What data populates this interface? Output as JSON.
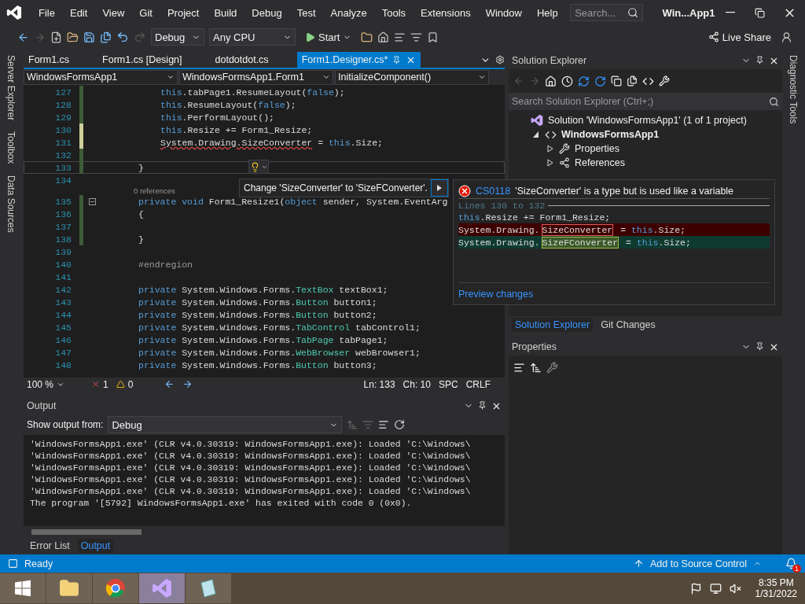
{
  "menubar": {
    "menus": [
      "File",
      "Edit",
      "View",
      "Git",
      "Project",
      "Build",
      "Debug",
      "Test",
      "Analyze",
      "Tools",
      "Extensions",
      "Window",
      "Help"
    ],
    "search": {
      "placeholder": "Search..."
    },
    "title": "Win...App1"
  },
  "toolbar": {
    "configuration": "Debug",
    "platform": "Any CPU",
    "start": "Start",
    "live_share": "Live Share"
  },
  "left_tabs": [
    "Server Explorer",
    "Toolbox",
    "Data Sources"
  ],
  "right_tabs": [
    "Diagnostic Tools"
  ],
  "editor": {
    "tabs": [
      {
        "label": "Form1.cs",
        "selected": false
      },
      {
        "label": "Form1.cs [Design]",
        "selected": false
      },
      {
        "label": "dotdotdot.cs",
        "selected": false
      },
      {
        "label": "Form1.Designer.cs*",
        "selected": true
      }
    ],
    "nav": [
      "WindowsFormsApp1",
      "WindowsFormsApp1.Form1",
      "InitializeComponent()"
    ],
    "lines": [
      {
        "n": "127",
        "kind": "body",
        "changed": true,
        "unsaved": false,
        "current": false,
        "fold": false,
        "tokens": [
          {
            "text": "this",
            "kind": "keyword"
          },
          {
            "text": ".tabPage1.ResumeLayout(",
            "kind": "plain"
          },
          {
            "text": "false",
            "kind": "keyword"
          },
          {
            "text": ");",
            "kind": "plain"
          }
        ]
      },
      {
        "n": "128",
        "kind": "body",
        "changed": true,
        "unsaved": false,
        "current": false,
        "fold": false,
        "tokens": [
          {
            "text": "this",
            "kind": "keyword"
          },
          {
            "text": ".ResumeLayout(",
            "kind": "plain"
          },
          {
            "text": "false",
            "kind": "keyword"
          },
          {
            "text": ");",
            "kind": "plain"
          }
        ]
      },
      {
        "n": "129",
        "kind": "body",
        "changed": true,
        "unsaved": false,
        "current": false,
        "fold": false,
        "tokens": [
          {
            "text": "this",
            "kind": "keyword"
          },
          {
            "text": ".PerformLayout();",
            "kind": "plain"
          }
        ]
      },
      {
        "n": "130",
        "kind": "body",
        "changed": true,
        "unsaved": true,
        "current": false,
        "fold": false,
        "tokens": [
          {
            "text": "this",
            "kind": "keyword"
          },
          {
            "text": ".Resize += Form1_Resize;",
            "kind": "plain"
          }
        ]
      },
      {
        "n": "131",
        "kind": "body",
        "changed": true,
        "unsaved": true,
        "current": false,
        "fold": false,
        "tokens": [
          {
            "text": "System.Drawing.SizeConverter",
            "kind": "error"
          },
          {
            "text": " = ",
            "kind": "plain"
          },
          {
            "text": "this",
            "kind": "keyword"
          },
          {
            "text": ".Size;",
            "kind": "plain"
          }
        ]
      },
      {
        "n": "132",
        "kind": "body",
        "changed": true,
        "unsaved": false,
        "current": false,
        "fold": false
      },
      {
        "n": "133",
        "kind": "member",
        "changed": true,
        "unsaved": false,
        "current": true,
        "fold": false,
        "tokens": [
          {
            "text": "}",
            "kind": "plain"
          }
        ]
      },
      {
        "n": "134",
        "kind": "member",
        "changed": false,
        "unsaved": false,
        "current": false,
        "fold": false
      },
      {
        "n": "135",
        "kind": "member",
        "changed": true,
        "unsaved": false,
        "current": false,
        "fold": true,
        "lens": "0 references",
        "tokens": [
          {
            "text": "private",
            "kind": "keyword"
          },
          {
            "text": " void",
            "kind": "keyword"
          },
          {
            "text": " Form1_Resize1(",
            "kind": "plain"
          },
          {
            "text": "object",
            "kind": "keyword"
          },
          {
            "text": " sender, System.EventArg",
            "kind": "plain"
          }
        ]
      },
      {
        "n": "136",
        "kind": "member",
        "changed": true,
        "unsaved": false,
        "current": false,
        "fold": false,
        "tokens": [
          {
            "text": "{",
            "kind": "plain"
          }
        ]
      },
      {
        "n": "137",
        "kind": "member",
        "changed": true,
        "unsaved": false,
        "current": false,
        "fold": false
      },
      {
        "n": "138",
        "kind": "member",
        "changed": true,
        "unsaved": false,
        "current": false,
        "fold": false,
        "tokens": [
          {
            "text": "}",
            "kind": "plain"
          }
        ]
      },
      {
        "n": "139",
        "kind": "member",
        "changed": false,
        "unsaved": false,
        "current": false,
        "fold": false
      },
      {
        "n": "140",
        "kind": "member",
        "changed": false,
        "unsaved": false,
        "current": false,
        "fold": false,
        "tokens": [
          {
            "text": "#endregion",
            "kind": "muted"
          }
        ]
      },
      {
        "n": "141",
        "kind": "member",
        "changed": false,
        "unsaved": false,
        "current": false,
        "fold": false
      },
      {
        "n": "142",
        "kind": "member",
        "changed": false,
        "unsaved": false,
        "current": false,
        "fold": false,
        "tokens": [
          {
            "text": "private",
            "kind": "keyword"
          },
          {
            "text": " System.Windows.Forms.",
            "kind": "plain"
          },
          {
            "text": "TextBox",
            "kind": "type"
          },
          {
            "text": " textBox1;",
            "kind": "plain"
          }
        ]
      },
      {
        "n": "143",
        "kind": "member",
        "changed": false,
        "unsaved": false,
        "current": false,
        "fold": false,
        "tokens": [
          {
            "text": "private",
            "kind": "keyword"
          },
          {
            "text": " System.Windows.Forms.",
            "kind": "plain"
          },
          {
            "text": "Button",
            "kind": "type"
          },
          {
            "text": " button1;",
            "kind": "plain"
          }
        ]
      },
      {
        "n": "144",
        "kind": "member",
        "changed": false,
        "unsaved": false,
        "current": false,
        "fold": false,
        "tokens": [
          {
            "text": "private",
            "kind": "keyword"
          },
          {
            "text": " System.Windows.Forms.",
            "kind": "plain"
          },
          {
            "text": "Button",
            "kind": "type"
          },
          {
            "text": " button2;",
            "kind": "plain"
          }
        ]
      },
      {
        "n": "145",
        "kind": "member",
        "changed": false,
        "unsaved": false,
        "current": false,
        "fold": false,
        "tokens": [
          {
            "text": "private",
            "kind": "keyword"
          },
          {
            "text": " System.Windows.Forms.",
            "kind": "plain"
          },
          {
            "text": "TabControl",
            "kind": "type"
          },
          {
            "text": " tabControl1;",
            "kind": "plain"
          }
        ]
      },
      {
        "n": "146",
        "kind": "member",
        "changed": false,
        "unsaved": false,
        "current": false,
        "fold": false,
        "tokens": [
          {
            "text": "private",
            "kind": "keyword"
          },
          {
            "text": " System.Windows.Forms.",
            "kind": "plain"
          },
          {
            "text": "TabPage",
            "kind": "type"
          },
          {
            "text": " tabPage1;",
            "kind": "plain"
          }
        ]
      },
      {
        "n": "147",
        "kind": "member",
        "changed": false,
        "unsaved": false,
        "current": false,
        "fold": false,
        "tokens": [
          {
            "text": "private",
            "kind": "keyword"
          },
          {
            "text": " System.Windows.Forms.",
            "kind": "plain"
          },
          {
            "text": "WebBrowser",
            "kind": "type"
          },
          {
            "text": " webBrowser1;",
            "kind": "plain"
          }
        ]
      },
      {
        "n": "148",
        "kind": "member",
        "changed": false,
        "unsaved": false,
        "current": false,
        "fold": false,
        "tokens": [
          {
            "text": "private",
            "kind": "keyword"
          },
          {
            "text": " System.Windows.Forms.",
            "kind": "plain"
          },
          {
            "text": "Button",
            "kind": "type"
          },
          {
            "text": " button3;",
            "kind": "plain"
          }
        ]
      }
    ],
    "status": {
      "zoom": "100 %",
      "errors": "1",
      "warnings": "0",
      "line": "Ln: 133",
      "column": "Ch: 10",
      "spacing": "SPC",
      "line_ending": "CRLF"
    }
  },
  "quick_action": {
    "label": "Change 'SizeConverter' to 'SizeFConverter'.",
    "preview": {
      "code": "CS0118",
      "message": "'SizeConverter' is a type but is used like a variable",
      "range": "Lines 130 to 132",
      "lines": [
        {
          "kind": "context",
          "tokens": [
            {
              "text": "this",
              "kind": "keyword"
            },
            {
              "text": ".Resize += Form1_Resize;",
              "kind": "plain"
            }
          ]
        },
        {
          "kind": "removed",
          "tokens": [
            {
              "text": "System.Drawing.",
              "kind": "plain"
            },
            {
              "text": "SizeConverter",
              "kind": "mark"
            },
            {
              "text": " = ",
              "kind": "plain"
            },
            {
              "text": "this",
              "kind": "keyword"
            },
            {
              "text": ".Size;",
              "kind": "plain"
            }
          ]
        },
        {
          "kind": "added",
          "tokens": [
            {
              "text": "System.Drawing.",
              "kind": "plain"
            },
            {
              "text": "SizeFConverter",
              "kind": "mark"
            },
            {
              "text": " = ",
              "kind": "plain"
            },
            {
              "text": "this",
              "kind": "keyword"
            },
            {
              "text": ".Size;",
              "kind": "plain"
            }
          ]
        }
      ],
      "link": "Preview changes"
    }
  },
  "output": {
    "title": "Output",
    "source_label": "Show output from:",
    "source": "Debug",
    "lines": [
      "'WindowsFormsApp1.exe' (CLR v4.0.30319: WindowsFormsApp1.exe): Loaded 'C:\\Windows\\",
      "'WindowsFormsApp1.exe' (CLR v4.0.30319: WindowsFormsApp1.exe): Loaded 'C:\\Windows\\",
      "'WindowsFormsApp1.exe' (CLR v4.0.30319: WindowsFormsApp1.exe): Loaded 'C:\\Windows\\",
      "'WindowsFormsApp1.exe' (CLR v4.0.30319: WindowsFormsApp1.exe): Loaded 'C:\\Windows\\",
      "'WindowsFormsApp1.exe' (CLR v4.0.30319: WindowsFormsApp1.exe): Loaded 'C:\\Windows\\",
      "The program '[5792] WindowsFormsApp1.exe' has exited with code 0 (0x0)."
    ]
  },
  "bottom_tabs": [
    {
      "label": "Error List",
      "selected": false
    },
    {
      "label": "Output",
      "selected": true
    }
  ],
  "solution_explorer": {
    "title": "Solution Explorer",
    "search": {
      "placeholder": "Search Solution Explorer (Ctrl+;)"
    },
    "tree": [
      {
        "label": "Solution 'WindowsFormsApp1' (1 of 1 project)",
        "kind": "solution",
        "children": [
          {
            "label": "WindowsFormsApp1",
            "kind": "project",
            "expanded": true,
            "children": [
              {
                "label": "Properties",
                "kind": "properties",
                "expanded": false
              },
              {
                "label": "References",
                "kind": "references",
                "expanded": false
              }
            ]
          }
        ]
      }
    ]
  },
  "explorer_tabs": [
    {
      "label": "Solution Explorer",
      "selected": true
    },
    {
      "label": "Git Changes",
      "selected": false
    }
  ],
  "properties": {
    "title": "Properties"
  },
  "status_bar": {
    "text": "Ready",
    "source_control": "Add to Source Control",
    "notifications": "1"
  },
  "taskbar": {
    "apps": [
      {
        "kind": "files",
        "selected": false
      },
      {
        "kind": "browser",
        "selected": false
      },
      {
        "kind": "studio",
        "selected": true
      },
      {
        "kind": "notes",
        "selected": false
      }
    ],
    "time": "8:35 PM",
    "date": "1/31/2022"
  }
}
